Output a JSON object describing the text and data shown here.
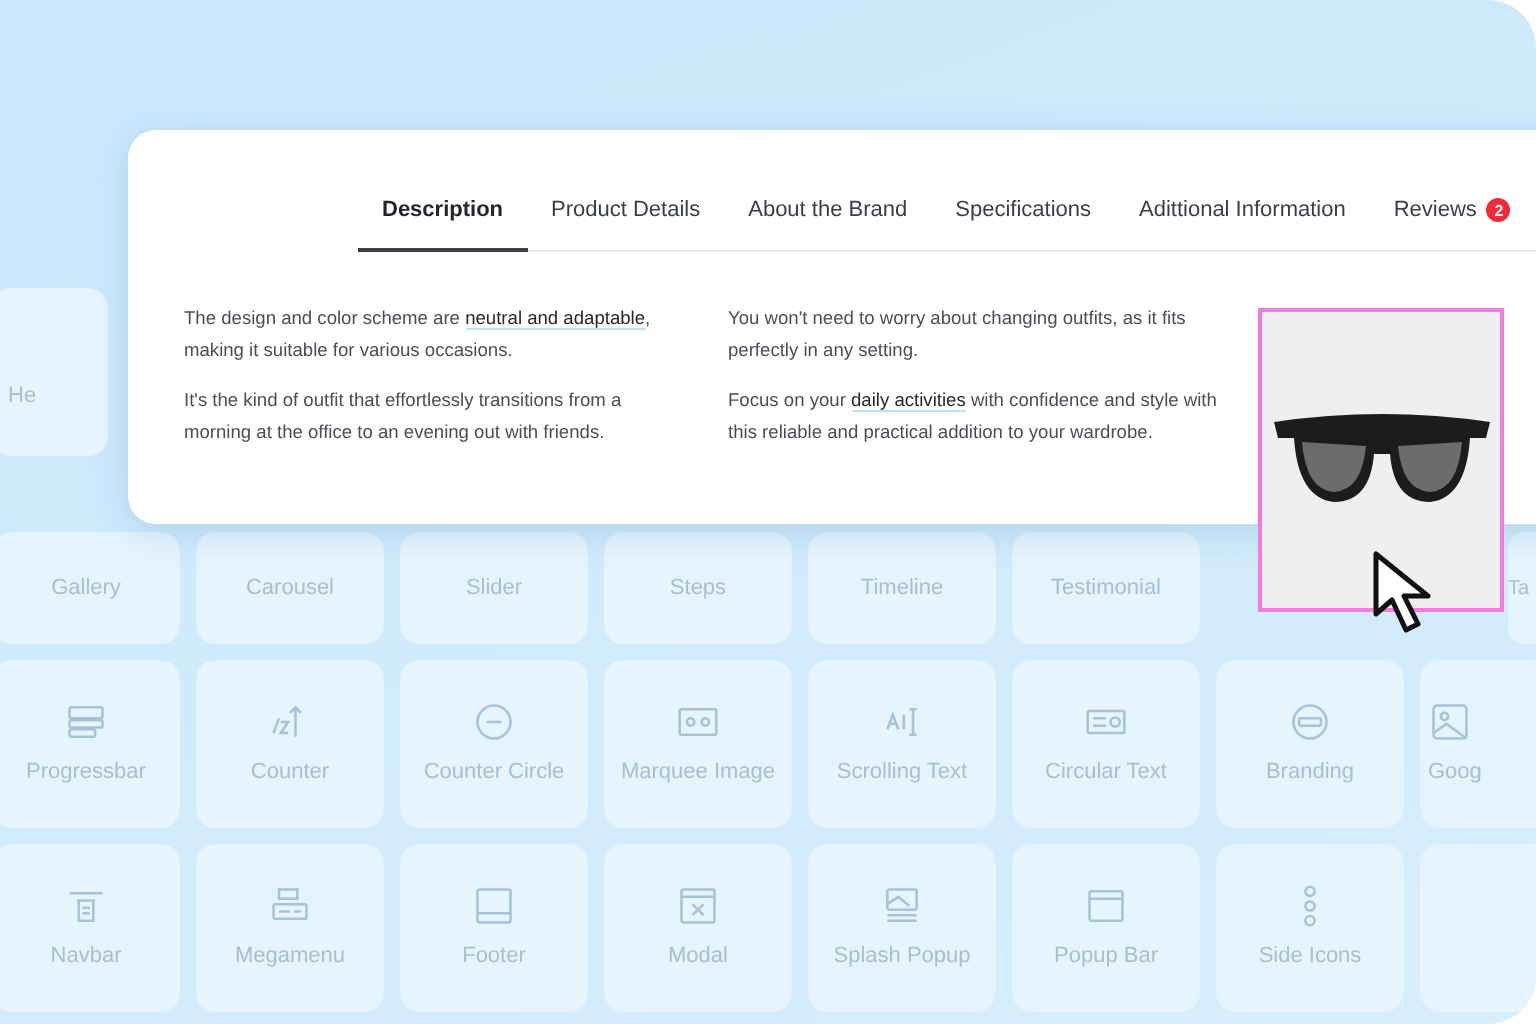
{
  "tabs": [
    {
      "label": "Description",
      "selected": true
    },
    {
      "label": "Product Details",
      "selected": false
    },
    {
      "label": "About the Brand",
      "selected": false
    },
    {
      "label": "Specifications",
      "selected": false
    },
    {
      "label": "Adittional Information",
      "selected": false
    },
    {
      "label": "Reviews",
      "selected": false,
      "badge": "2"
    }
  ],
  "description": {
    "columns": [
      [
        "The design and color scheme are **neutral and adaptable**, making it suitable for various occasions.",
        "It's the kind of outfit that effortlessly transitions from a morning at the office to an evening out with friends."
      ],
      [
        "You won't need to worry about changing outfits, as it fits perfectly in any setting.",
        "Focus on your **daily activities** with confidence and style with this reliable and practical addition to your wardrobe."
      ]
    ]
  },
  "tile_rows": [
    [
      {
        "label": "He"
      }
    ],
    [
      {
        "label": "Gallery"
      },
      {
        "label": "Carousel"
      },
      {
        "label": "Slider"
      },
      {
        "label": "Steps"
      },
      {
        "label": "Timeline"
      },
      {
        "label": "Testimonial"
      },
      {
        "label": "Ta"
      }
    ],
    [
      {
        "label": "Progressbar"
      },
      {
        "label": "Counter"
      },
      {
        "label": "Counter Circle"
      },
      {
        "label": "Marquee Image"
      },
      {
        "label": "Scrolling Text"
      },
      {
        "label": "Circular Text"
      },
      {
        "label": "Branding"
      },
      {
        "label": "Goog"
      }
    ],
    [
      {
        "label": "Navbar"
      },
      {
        "label": "Megamenu"
      },
      {
        "label": "Footer"
      },
      {
        "label": "Modal"
      },
      {
        "label": "Splash Popup"
      },
      {
        "label": "Popup Bar"
      },
      {
        "label": "Side Icons"
      },
      {}
    ]
  ]
}
